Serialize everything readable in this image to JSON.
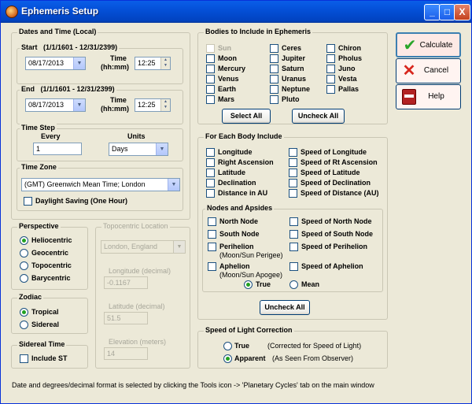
{
  "window": {
    "title": "Ephemeris Setup",
    "minimize": "_",
    "maximize": "□",
    "close": "X"
  },
  "dates": {
    "group_label": "Dates and Time (Local)",
    "start_label": "Start",
    "start_range": "(1/1/1601 - 12/31/2399)",
    "start_date": "08/17/2013",
    "start_time_label": "Time",
    "start_time_sub": "(hh:mm)",
    "start_time": "12:25",
    "end_label": "End",
    "end_range": "(1/1/1601 - 12/31/2399)",
    "end_date": "08/17/2013",
    "end_time_label": "Time",
    "end_time_sub": "(hh:mm)",
    "end_time": "12:25"
  },
  "timestep": {
    "group_label": "Time Step",
    "every_label": "Every",
    "every_value": "1",
    "units_label": "Units",
    "units_value": "Days"
  },
  "timezone": {
    "group_label": "Time Zone",
    "value": "(GMT) Greenwich Mean Time; London",
    "daylight_label": "Daylight Saving (One Hour)"
  },
  "perspective": {
    "group_label": "Perspective",
    "options": [
      "Heliocentric",
      "Geocentric",
      "Topocentric",
      "Barycentric"
    ],
    "selected": "Heliocentric"
  },
  "zodiac": {
    "group_label": "Zodiac",
    "options": [
      "Tropical",
      "Sidereal"
    ],
    "selected": "Tropical"
  },
  "sidereal_time": {
    "group_label": "Sidereal Time",
    "include_label": "Include ST"
  },
  "topocentric": {
    "group_label": "Topocentric Location",
    "location": "London, England",
    "longitude_label": "Longitude (decimal)",
    "longitude": "-0.1167",
    "latitude_label": "Latitude (decimal)",
    "latitude": "51.5",
    "elevation_label": "Elevation (meters)",
    "elevation": "14"
  },
  "bodies": {
    "group_label": "Bodies to Include in Ephemeris",
    "col1": [
      "Sun",
      "Moon",
      "Mercury",
      "Venus",
      "Earth",
      "Mars"
    ],
    "col2": [
      "Ceres",
      "Jupiter",
      "Saturn",
      "Uranus",
      "Neptune",
      "Pluto"
    ],
    "col3": [
      "Chiron",
      "Pholus",
      "Juno",
      "Vesta",
      "Pallas"
    ],
    "select_all": "Select All",
    "uncheck_all": "Uncheck All"
  },
  "each_body": {
    "group_label": "For Each Body Include",
    "left": [
      "Longitude",
      "Right Ascension",
      "Latitude",
      "Declination",
      "Distance in AU"
    ],
    "right": [
      "Speed of Longitude",
      "Speed of Rt Ascension",
      "Speed of Latitude",
      "Speed of Declination",
      "Speed of Distance (AU)"
    ]
  },
  "nodes": {
    "group_label": "Nodes and Apsides",
    "north_node": "North Node",
    "speed_north": "Speed of North Node",
    "south_node": "South Node",
    "speed_south": "Speed of South Node",
    "perihelion": "Perihelion",
    "perihelion_sub": "(Moon/Sun Perigee)",
    "speed_perihelion": "Speed of Perihelion",
    "aphelion": "Aphelion",
    "aphelion_sub": "(Moon/Sun Apogee)",
    "speed_aphelion": "Speed of Aphelion",
    "true_label": "True",
    "mean_label": "Mean",
    "selected": "True",
    "uncheck_all": "Uncheck All"
  },
  "light": {
    "group_label": "Speed of Light Correction",
    "true_label": "True",
    "true_desc": "(Corrected for Speed of Light)",
    "apparent_label": "Apparent",
    "apparent_desc": "(As Seen From Observer)",
    "selected": "Apparent"
  },
  "actions": {
    "calculate": "Calculate",
    "cancel": "Cancel",
    "help": "Help"
  },
  "footer": "Date and degrees/decimal format is selected by clicking the Tools icon -> 'Planetary Cycles' tab on the main window",
  "icons": {
    "calculate": "checkmark-icon",
    "cancel": "x-cross-icon",
    "help": "help-book-icon"
  },
  "colors": {
    "titlebar": "#0450d8",
    "window_bg": "#ece9d8",
    "radio_dot": "#21a121",
    "check_green": "#2aa52a",
    "cancel_red": "#d8261d"
  }
}
